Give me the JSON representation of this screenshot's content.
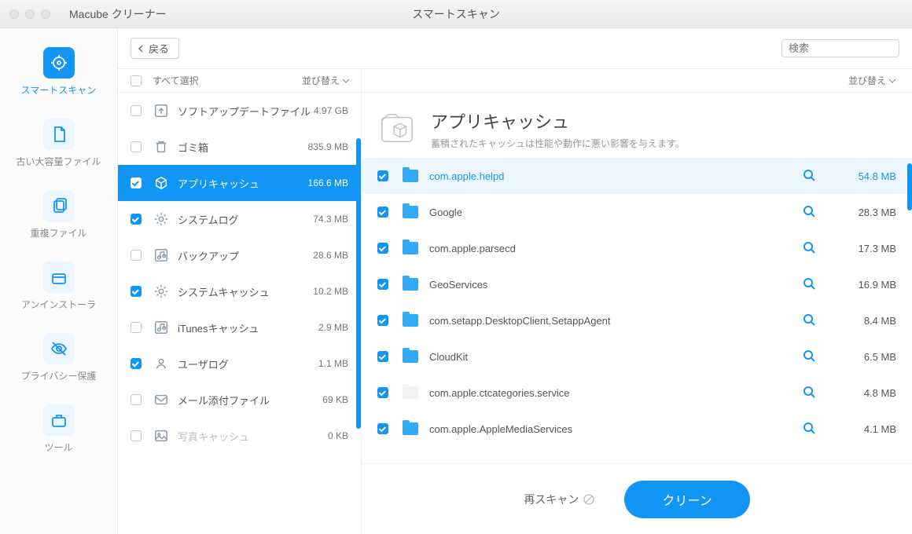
{
  "titlebar": {
    "app": "Macube クリーナー",
    "title": "スマートスキャン"
  },
  "sidebar": [
    {
      "label": "スマートスキャン",
      "icon": "target",
      "active": true
    },
    {
      "label": "古い大容量ファイル",
      "icon": "file"
    },
    {
      "label": "重複ファイル",
      "icon": "copy"
    },
    {
      "label": "アンインストーラ",
      "icon": "box"
    },
    {
      "label": "プライバシー保護",
      "icon": "eye-off"
    },
    {
      "label": "ツール",
      "icon": "toolbox"
    }
  ],
  "toolbar": {
    "back": "戻る"
  },
  "search": {
    "placeholder": "検索"
  },
  "catHeader": {
    "selectAll": "すべて選択",
    "sort": "並び替え"
  },
  "cats": [
    {
      "label": "ソフトアップデートファイル",
      "size": "4.97 GB",
      "icon": "upload"
    },
    {
      "label": "ゴミ箱",
      "size": "835.9 MB",
      "icon": "trash"
    },
    {
      "label": "アプリキャッシュ",
      "size": "166.6 MB",
      "icon": "cube",
      "active": true,
      "checked": true
    },
    {
      "label": "システムログ",
      "size": "74.3 MB",
      "icon": "gear",
      "checked": true
    },
    {
      "label": "バックアップ",
      "size": "28.6 MB",
      "icon": "music"
    },
    {
      "label": "システムキャッシュ",
      "size": "10.2 MB",
      "icon": "gear",
      "checked": true
    },
    {
      "label": "iTunesキャッシュ",
      "size": "2.9 MB",
      "icon": "music"
    },
    {
      "label": "ユーザログ",
      "size": "1.1 MB",
      "icon": "user",
      "checked": true
    },
    {
      "label": "メール添付ファイル",
      "size": "69 KB",
      "icon": "mail"
    },
    {
      "label": "写真キャッシュ",
      "size": "0 KB",
      "icon": "image",
      "disabled": true
    }
  ],
  "detail": {
    "title": "アプリキャッシュ",
    "subtitle": "蓄積されたキャッシュは性能や動作に悪い影響を与えます。",
    "sort": "並び替え",
    "items": [
      {
        "name": "com.apple.helpd",
        "size": "54.8 MB",
        "checked": true,
        "sel": true
      },
      {
        "name": "Google",
        "size": "28.3 MB",
        "checked": true
      },
      {
        "name": "com.apple.parsecd",
        "size": "17.3 MB",
        "checked": true
      },
      {
        "name": "GeoServices",
        "size": "16.9 MB",
        "checked": true
      },
      {
        "name": "com.setapp.DesktopClient.SetappAgent",
        "size": "8.4 MB",
        "checked": true
      },
      {
        "name": "CloudKit",
        "size": "6.5 MB",
        "checked": true
      },
      {
        "name": "com.apple.ctcategories.service",
        "size": "4.8 MB",
        "checked": true,
        "plain": true
      },
      {
        "name": "com.apple.AppleMediaServices",
        "size": "4.1 MB",
        "checked": true
      }
    ]
  },
  "footer": {
    "rescan": "再スキャン",
    "clean": "クリーン"
  }
}
